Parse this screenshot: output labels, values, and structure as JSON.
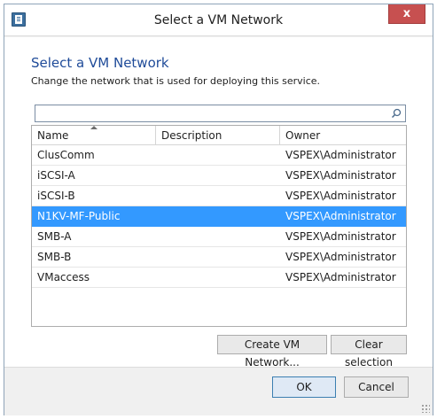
{
  "window": {
    "title": "Select a VM Network",
    "close_label": "x"
  },
  "content": {
    "heading": "Select a VM Network",
    "subtext": "Change the network that is used for deploying this service."
  },
  "search": {
    "value": "",
    "placeholder": ""
  },
  "grid": {
    "columns": [
      "Name",
      "Description",
      "Owner"
    ],
    "sort_column": "Name",
    "sort_direction": "ascending",
    "rows": [
      {
        "name": "ClusComm",
        "description": "",
        "owner": "VSPEX\\Administrator",
        "selected": false
      },
      {
        "name": "iSCSI-A",
        "description": "",
        "owner": "VSPEX\\Administrator",
        "selected": false
      },
      {
        "name": "iSCSI-B",
        "description": "",
        "owner": "VSPEX\\Administrator",
        "selected": false
      },
      {
        "name": "N1KV-MF-Public",
        "description": "",
        "owner": "VSPEX\\Administrator",
        "selected": true
      },
      {
        "name": "SMB-A",
        "description": "",
        "owner": "VSPEX\\Administrator",
        "selected": false
      },
      {
        "name": "SMB-B",
        "description": "",
        "owner": "VSPEX\\Administrator",
        "selected": false
      },
      {
        "name": "VMaccess",
        "description": "",
        "owner": "VSPEX\\Administrator",
        "selected": false
      }
    ]
  },
  "actions": {
    "create_label": "Create VM Network...",
    "clear_label": "Clear selection"
  },
  "footer": {
    "ok_label": "OK",
    "cancel_label": "Cancel"
  },
  "colors": {
    "heading": "#1f4b99",
    "selection": "#3399ff",
    "close_button": "#c75050"
  }
}
